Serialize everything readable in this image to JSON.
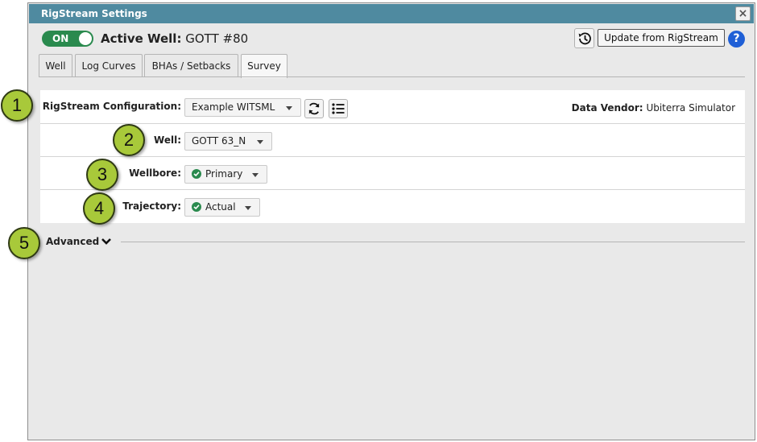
{
  "dialog": {
    "title": "RigStream Settings",
    "close_icon": "×"
  },
  "header": {
    "toggle_label": "ON",
    "active_well_label": "Active Well:",
    "active_well_value": "GOTT #80",
    "update_button": "Update from RigStream",
    "help_icon": "?"
  },
  "tabs": [
    {
      "label": "Well"
    },
    {
      "label": "Log Curves"
    },
    {
      "label": "BHAs / Setbacks"
    },
    {
      "label": "Survey"
    }
  ],
  "active_tab": "Survey",
  "form": {
    "config_label": "RigStream Configuration:",
    "config_value": "Example WITSML",
    "vendor_label": "Data Vendor:",
    "vendor_value": "Ubiterra Simulator",
    "well_label": "Well:",
    "well_value": "GOTT 63_N",
    "wellbore_label": "Wellbore:",
    "wellbore_value": "Primary",
    "trajectory_label": "Trajectory:",
    "trajectory_value": "Actual"
  },
  "advanced": {
    "label": "Advanced"
  },
  "callouts": [
    "1",
    "2",
    "3",
    "4",
    "5"
  ],
  "colors": {
    "titlebar": "#4f8aa0",
    "toggle_on": "#2a8a4e",
    "help": "#1f5fd6",
    "callout": "#a8c93a"
  },
  "icons": {
    "history": "history-icon",
    "refresh": "refresh-icon",
    "list": "list-icon",
    "check": "check-circle-icon",
    "chevron": "chevron-down-icon"
  }
}
